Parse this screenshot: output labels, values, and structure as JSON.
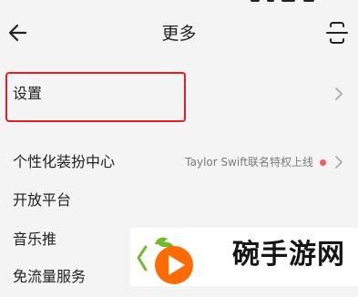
{
  "header": {
    "title": "更多",
    "back_icon": "back-arrow-icon",
    "scan_icon": "scan-icon"
  },
  "items": [
    {
      "label": "设置",
      "hint": "",
      "chevron_icon": "chevron-right-icon",
      "highlighted": true
    },
    {
      "label": "个性化装扮中心",
      "hint": "Taylor Swift联名特权上线",
      "badge": "red-dot",
      "chevron_icon": "chevron-right-icon"
    },
    {
      "label": "开放平台"
    },
    {
      "label": "音乐推"
    },
    {
      "label": "免流量服务"
    }
  ],
  "watermark": {
    "text": "碗手游网",
    "logo_icon": "play-logo-icon"
  },
  "colors": {
    "background": "#f4f4f4",
    "text": "#222222",
    "hint": "#7b7b7b",
    "highlight_border": "#e51d25",
    "badge": "#ff5b5b",
    "watermark_orange": "#ff6b00",
    "watermark_green": "#74b92d"
  }
}
